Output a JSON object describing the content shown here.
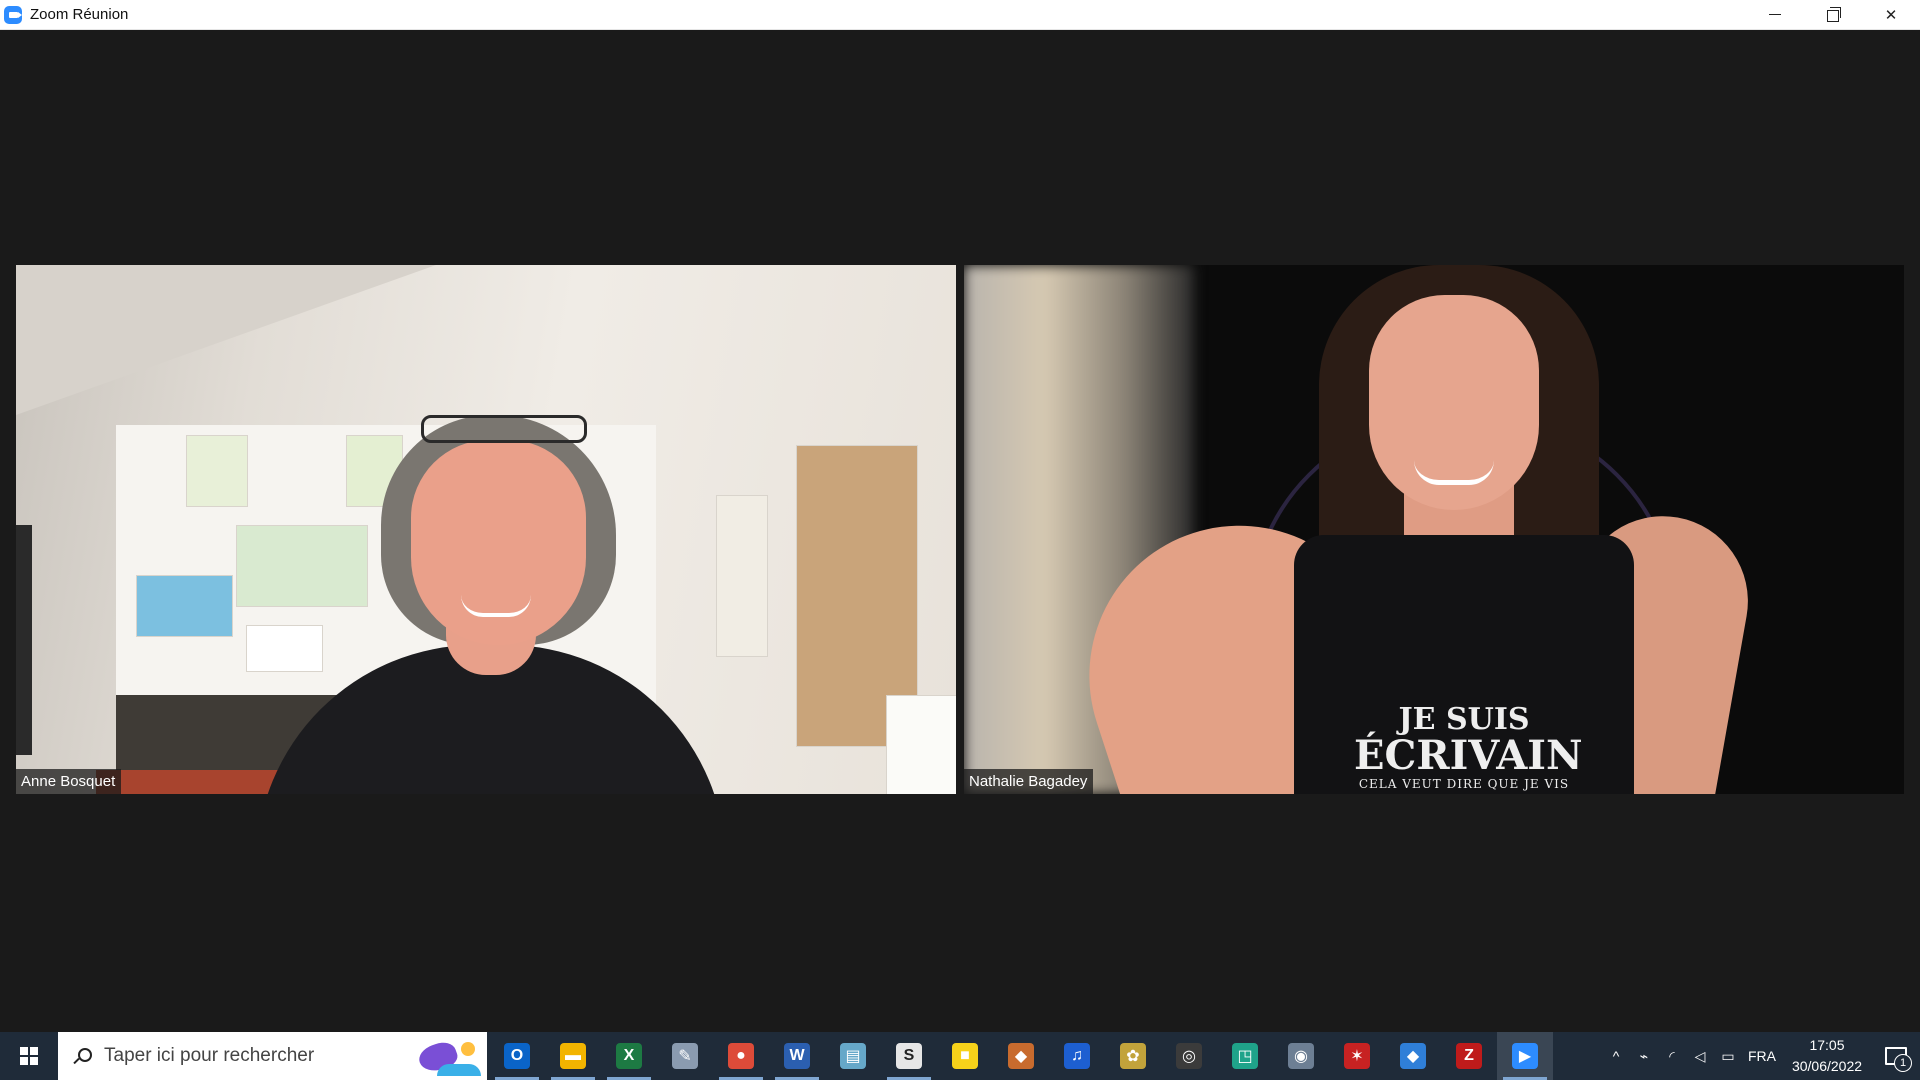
{
  "window": {
    "title": "Zoom Réunion",
    "minimize_icon": "minimize-icon",
    "maximize_icon": "restore-icon",
    "close_icon": "close-icon",
    "close_glyph": "✕"
  },
  "participants": [
    {
      "name": "Anne Bosquet"
    },
    {
      "name": "Nathalie Bagadey"
    }
  ],
  "shirt": {
    "line1": "JE SUIS",
    "line2": "ÉCRIVAIN",
    "line3": "CELA VEUT DIRE QUE JE VIS"
  },
  "taskbar": {
    "search_placeholder": "Taper ici pour rechercher",
    "apps": [
      {
        "name": "outlook",
        "glyph": "O",
        "color": "#0a64c8",
        "running": true
      },
      {
        "name": "file-explorer",
        "glyph": "▬",
        "color": "#f2b400",
        "running": true
      },
      {
        "name": "excel",
        "glyph": "X",
        "color": "#1d7a43",
        "running": true
      },
      {
        "name": "paint",
        "glyph": "✎",
        "color": "#8a9bb0",
        "running": false
      },
      {
        "name": "chrome",
        "glyph": "●",
        "color": "#dd4b39",
        "running": true
      },
      {
        "name": "word",
        "glyph": "W",
        "color": "#2b5fb0",
        "running": true
      },
      {
        "name": "notes",
        "glyph": "▤",
        "color": "#66a8c9",
        "running": false
      },
      {
        "name": "scrivener",
        "glyph": "S",
        "color": "#e6e6e6",
        "running": true
      },
      {
        "name": "sticky-notes",
        "glyph": "■",
        "color": "#f7d21a",
        "running": false
      },
      {
        "name": "media-tool",
        "glyph": "◆",
        "color": "#c86b2e",
        "running": false
      },
      {
        "name": "audio-app",
        "glyph": "♫",
        "color": "#1d5fd1",
        "running": false
      },
      {
        "name": "game-app",
        "glyph": "✿",
        "color": "#c2a33b",
        "running": false
      },
      {
        "name": "obs",
        "glyph": "◎",
        "color": "#3b3b3b",
        "running": false
      },
      {
        "name": "capture-app",
        "glyph": "◳",
        "color": "#1fa38a",
        "running": false
      },
      {
        "name": "camera",
        "glyph": "◉",
        "color": "#6d7f94",
        "running": false
      },
      {
        "name": "dragon-app",
        "glyph": "✶",
        "color": "#c72222",
        "running": false
      },
      {
        "name": "sourcetree",
        "glyph": "◆",
        "color": "#2f7fd8",
        "running": false
      },
      {
        "name": "filezilla",
        "glyph": "Z",
        "color": "#bf1b1b",
        "running": false
      },
      {
        "name": "zoom",
        "glyph": "▶",
        "color": "#2d8cff",
        "running": true,
        "active": true
      }
    ],
    "tray": {
      "chevron": "^",
      "language": "FRA",
      "time": "17:05",
      "date": "30/06/2022",
      "notifications_count": "1"
    }
  }
}
